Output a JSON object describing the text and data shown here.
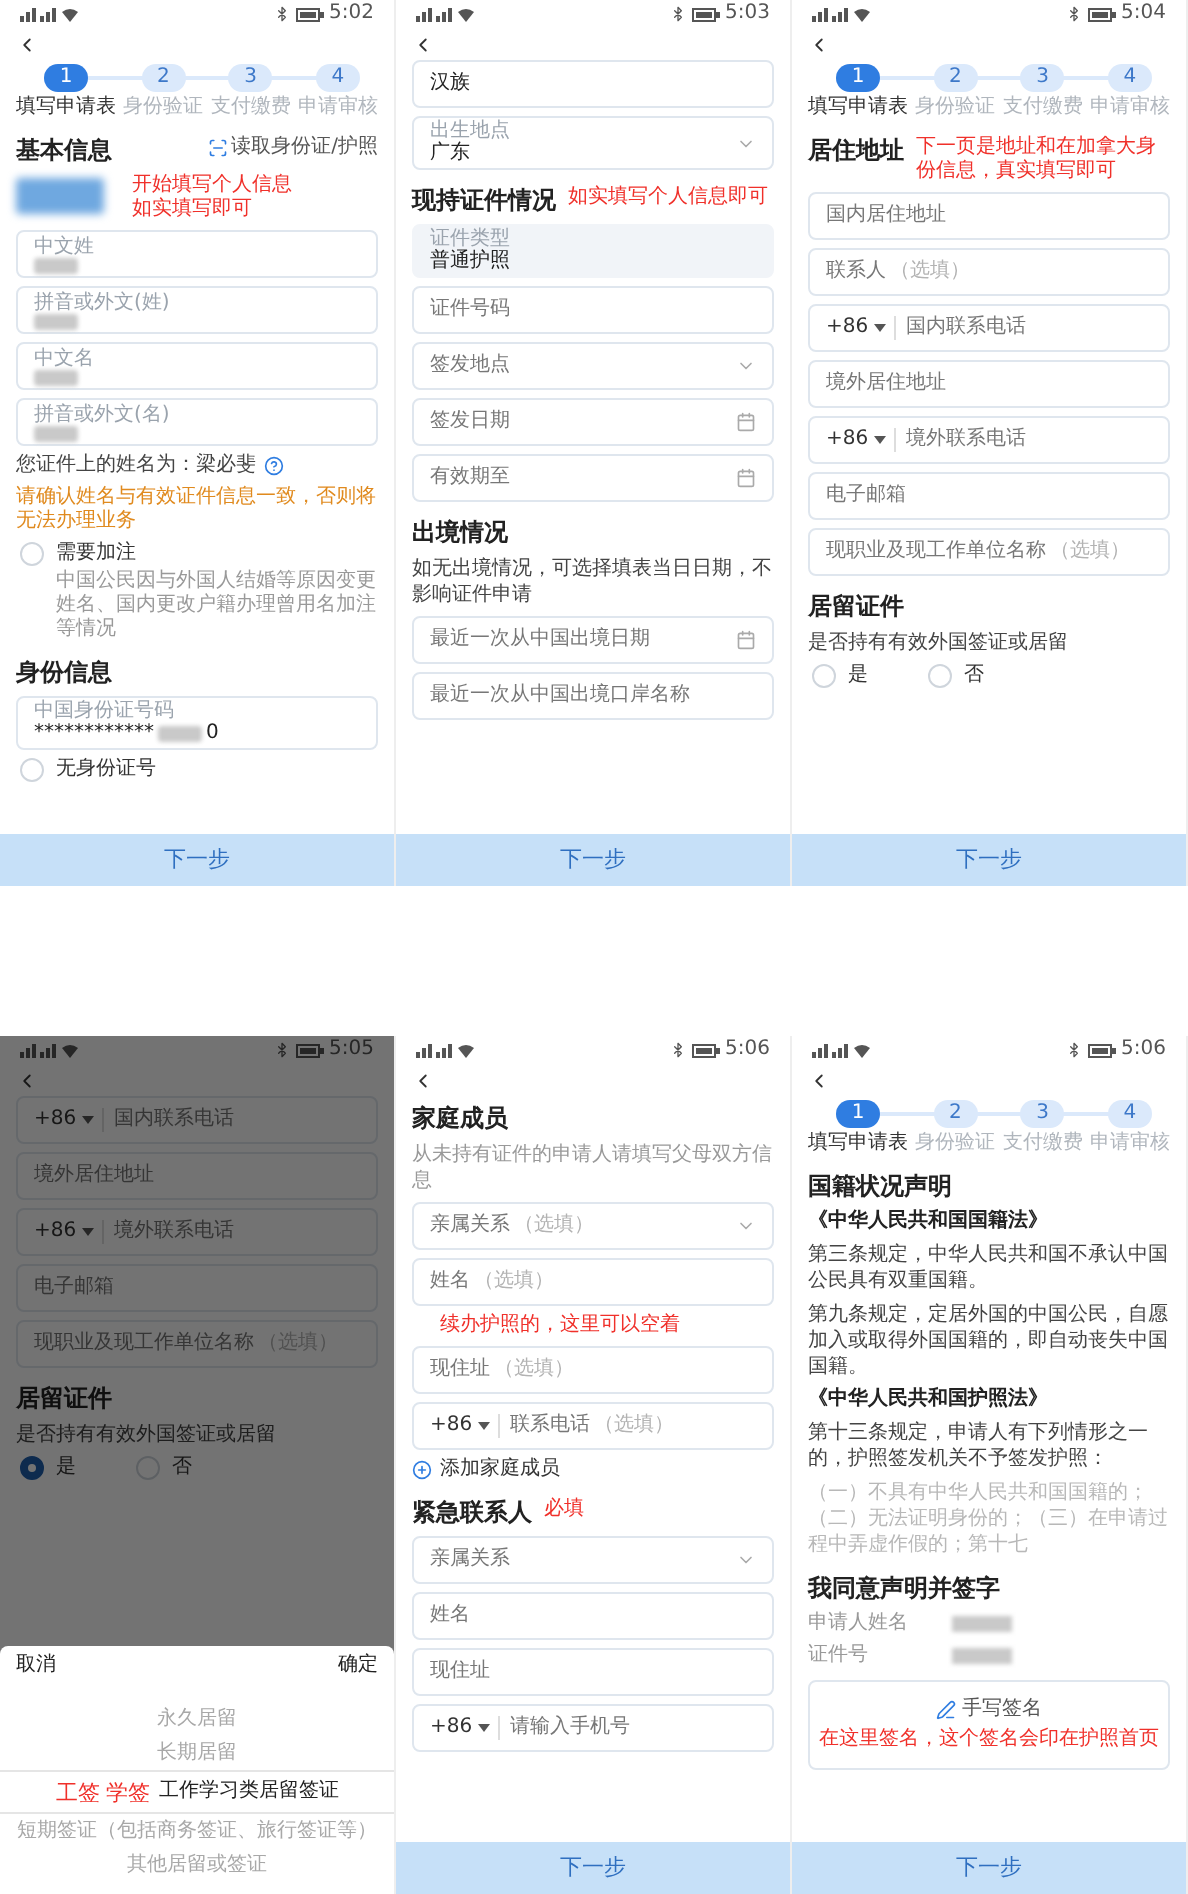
{
  "panels": [
    {
      "time": "5:02",
      "stepper": [
        {
          "number": "1",
          "label": "填写申请表",
          "selected": true
        },
        {
          "number": "2",
          "label": "身份验证",
          "selected": false
        },
        {
          "number": "3",
          "label": "支付缴费",
          "selected": false
        },
        {
          "number": "4",
          "label": "申请审核",
          "selected": false
        }
      ],
      "blocks": [
        {
          "kind": "heading",
          "text": "基本信息",
          "link": "读取身份证/护照"
        },
        {
          "kind": "redacted_note",
          "lines": [
            "开始填写个人信息",
            "如实填写即可"
          ]
        },
        {
          "kind": "field",
          "label": "中文姓",
          "redacted": true
        },
        {
          "kind": "field",
          "label": "拼音或外文(姓)",
          "redacted": true
        },
        {
          "kind": "field",
          "label": "中文名",
          "redacted": true
        },
        {
          "kind": "field",
          "label": "拼音或外文(名)",
          "redacted": true
        },
        {
          "kind": "help_text",
          "text": "您证件上的姓名为：梁必斐"
        },
        {
          "kind": "warning",
          "text": "请确认姓名与有效证件信息一致，否则将无法办理业务"
        },
        {
          "kind": "radio",
          "label": "需要加注",
          "checked": false,
          "description": "中国公民因与外国人结婚等原因变更姓名、国内更改户籍办理曾用名加注等情况"
        },
        {
          "kind": "heading",
          "text": "身份信息"
        },
        {
          "kind": "field",
          "label": "中国身份证号码",
          "value": "************",
          "redacted": true,
          "value_end": "0"
        },
        {
          "kind": "radio",
          "label": "无身份证号",
          "checked": false
        }
      ],
      "button": "下一步"
    },
    {
      "time": "5:03",
      "blocks": [
        {
          "kind": "field",
          "value": "汉族"
        },
        {
          "kind": "field",
          "label": "出生地点",
          "value": "广东",
          "dropdown": true
        },
        {
          "kind": "heading",
          "text": "现持证件情况",
          "annotation": "如实填写个人信息即可"
        },
        {
          "kind": "field",
          "label": "证件类型",
          "value": "普通护照",
          "filled": true
        },
        {
          "kind": "field",
          "placeholder": "证件号码"
        },
        {
          "kind": "field",
          "placeholder": "签发地点",
          "dropdown": true
        },
        {
          "kind": "field",
          "placeholder": "签发日期",
          "date_picker": true
        },
        {
          "kind": "field",
          "placeholder": "有效期至",
          "date_picker": true
        },
        {
          "kind": "heading",
          "text": "出境情况"
        },
        {
          "kind": "text",
          "text": "如无出境情况，可选择填表当日日期，不影响证件申请"
        },
        {
          "kind": "field",
          "placeholder": "最近一次从中国出境日期",
          "date_picker": true
        },
        {
          "kind": "field",
          "placeholder": "最近一次从中国出境口岸名称"
        }
      ],
      "button": "下一步"
    },
    {
      "time": "5:04",
      "stepper": [
        {
          "number": "1",
          "label": "填写申请表",
          "selected": true
        },
        {
          "number": "2",
          "label": "身份验证",
          "selected": false
        },
        {
          "number": "3",
          "label": "支付缴费",
          "selected": false
        },
        {
          "number": "4",
          "label": "申请审核",
          "selected": false
        }
      ],
      "blocks": [
        {
          "kind": "heading",
          "text": "居住地址",
          "annotation": "下一页是地址和在加拿大身份信息，真实填写即可"
        },
        {
          "kind": "field",
          "placeholder": "国内居住地址"
        },
        {
          "kind": "field",
          "placeholder": "联系人",
          "optional": "（选填）"
        },
        {
          "kind": "field",
          "prefix": "+86",
          "placeholder": "国内联系电话"
        },
        {
          "kind": "field",
          "placeholder": "境外居住地址"
        },
        {
          "kind": "field",
          "prefix": "+86",
          "placeholder": "境外联系电话"
        },
        {
          "kind": "field",
          "placeholder": "电子邮箱"
        },
        {
          "kind": "field",
          "placeholder": "现职业及现工作单位名称",
          "optional": "（选填）"
        },
        {
          "kind": "heading",
          "text": "居留证件"
        },
        {
          "kind": "text",
          "text": "是否持有有效外国签证或居留"
        },
        {
          "kind": "radio_group",
          "options": [
            {
              "label": "是",
              "selected": false
            },
            {
              "label": "否",
              "selected": false
            }
          ]
        }
      ],
      "button": "下一步"
    },
    {
      "time": "5:05",
      "blocks": [
        {
          "kind": "field",
          "prefix": "+86",
          "placeholder": "国内联系电话"
        },
        {
          "kind": "field",
          "placeholder": "境外居住地址"
        },
        {
          "kind": "field",
          "prefix": "+86",
          "placeholder": "境外联系电话"
        },
        {
          "kind": "field",
          "placeholder": "电子邮箱"
        },
        {
          "kind": "field",
          "placeholder": "现职业及现工作单位名称",
          "optional": "（选填）"
        },
        {
          "kind": "heading",
          "text": "居留证件"
        },
        {
          "kind": "text",
          "text": "是否持有有效外国签证或居留"
        },
        {
          "kind": "radio_group",
          "options": [
            {
              "label": "是",
              "selected": true
            },
            {
              "label": "否",
              "selected": false
            }
          ]
        }
      ],
      "picker": {
        "cancel": "取消",
        "confirm": "确定",
        "options": [
          {
            "label": "永久居留",
            "selected": false
          },
          {
            "label": "长期居留",
            "selected": false
          },
          {
            "label": "工作学习类居留签证",
            "selected": true,
            "note": "工签 学签"
          },
          {
            "label": "短期签证（包括商务签证、旅行签证等）",
            "selected": false
          },
          {
            "label": "其他居留或签证",
            "selected": false
          }
        ]
      }
    },
    {
      "time": "5:06",
      "blocks": [
        {
          "kind": "heading",
          "text": "家庭成员"
        },
        {
          "kind": "text",
          "muted": true,
          "text": "从未持有证件的申请人请填写父母双方信息"
        },
        {
          "kind": "field",
          "placeholder": "亲属关系",
          "optional": "（选填）",
          "dropdown": true
        },
        {
          "kind": "field",
          "placeholder": "姓名",
          "optional": "（选填）"
        },
        {
          "kind": "note",
          "text": "续办护照的，这里可以空着"
        },
        {
          "kind": "field",
          "placeholder": "现住址",
          "optional": "（选填）"
        },
        {
          "kind": "field",
          "prefix": "+86",
          "placeholder": "联系电话",
          "optional": "（选填）"
        },
        {
          "kind": "add_link",
          "text": "添加家庭成员"
        },
        {
          "kind": "heading",
          "text": "紧急联系人",
          "annotation": "必填"
        },
        {
          "kind": "field",
          "placeholder": "亲属关系",
          "dropdown": true
        },
        {
          "kind": "field",
          "placeholder": "姓名"
        },
        {
          "kind": "field",
          "placeholder": "现住址"
        },
        {
          "kind": "field",
          "prefix": "+86",
          "placeholder": "请输入手机号"
        }
      ],
      "button": "下一步"
    },
    {
      "time": "5:06",
      "stepper": [
        {
          "number": "1",
          "label": "填写申请表",
          "selected": true
        },
        {
          "number": "2",
          "label": "身份验证",
          "selected": false
        },
        {
          "number": "3",
          "label": "支付缴费",
          "selected": false
        },
        {
          "number": "4",
          "label": "申请审核",
          "selected": false
        }
      ],
      "blocks": [
        {
          "kind": "heading",
          "text": "国籍状况声明"
        },
        {
          "kind": "law_title",
          "text": "《中华人民共和国国籍法》"
        },
        {
          "kind": "text",
          "text": "第三条规定，中华人民共和国不承认中国公民具有双重国籍。"
        },
        {
          "kind": "text",
          "text": "第九条规定，定居外国的中国公民，自愿加入或取得外国国籍的，即自动丧失中国国籍。"
        },
        {
          "kind": "law_title",
          "text": "《中华人民共和国护照法》"
        },
        {
          "kind": "text",
          "text": "第十三条规定，申请人有下列情形之一的，护照签发机关不予签发护照："
        },
        {
          "kind": "text",
          "faded": true,
          "text": "（一）不具有中华人民共和国国籍的；（二）无法证明身份的；（三）在申请过程中弄虚作假的；第十七"
        },
        {
          "kind": "heading",
          "text": "我同意声明并签字"
        },
        {
          "kind": "info_row",
          "label": "申请人姓名"
        },
        {
          "kind": "info_row",
          "label": "证件号"
        },
        {
          "kind": "signature",
          "label": "手写签名",
          "note": "在这里签名，这个签名会印在护照首页"
        }
      ],
      "button": "下一步"
    }
  ]
}
